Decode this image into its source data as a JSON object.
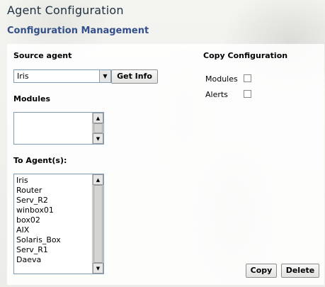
{
  "header": {
    "title": "Agent Configuration",
    "subtitle": "Configuration Management"
  },
  "source": {
    "label": "Source agent",
    "selected_agent": "Iris",
    "get_info_label": "Get Info",
    "modules_label": "Modules"
  },
  "copy_config": {
    "label": "Copy Configuration",
    "modules_label": "Modules",
    "modules_checked": false,
    "alerts_label": "Alerts",
    "alerts_checked": false
  },
  "destination": {
    "label": "To Agent(s):",
    "agents": [
      "Iris",
      "Router",
      "Serv_R2",
      "winbox01",
      "box02",
      "AIX",
      "Solaris_Box",
      "Serv_R1",
      "Daeva"
    ]
  },
  "actions": {
    "copy_label": "Copy",
    "delete_label": "Delete"
  },
  "icons": {
    "dropdown": "chevron-down-icon",
    "scroll_up": "scroll-up-arrow-icon",
    "scroll_down": "scroll-down-arrow-icon"
  }
}
